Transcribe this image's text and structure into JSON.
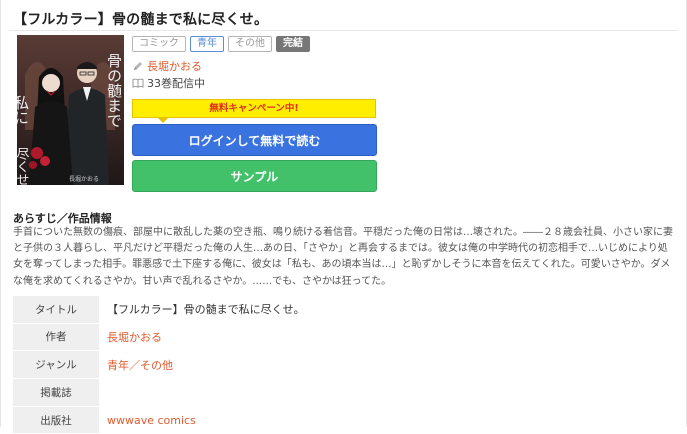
{
  "title": "【フルカラー】骨の髄まで私に尽くせ。",
  "tags": [
    {
      "label": "コミック",
      "style": "gray"
    },
    {
      "label": "青年",
      "style": "blue"
    },
    {
      "label": "その他",
      "style": "gray"
    },
    {
      "label": "完結",
      "style": "done"
    }
  ],
  "author": "長堀かおる",
  "volumes": "33巻配信中",
  "campaign": "無料キャンペーン中!",
  "buttons": {
    "login": "ログインして無料で読む",
    "sample": "サンプル"
  },
  "synopsis": {
    "heading": "あらすじ／作品情報",
    "text": "手首についた無数の傷痕、部屋中に散乱した薬の空き瓶、鳴り続ける着信音。平穏だった俺の日常は…壊された。――２８歳会社員、小さい家に妻と子供の３人暮らし、平凡だけど平穏だった俺の人生…あの日、「さやか」と再会するまでは。彼女は俺の中学時代の初恋相手で…いじめにより処女を奪ってしまった相手。罪悪感で土下座する俺に、彼女は「私も、あの頃本当は…」と恥ずかしそうに本音を伝えてくれた。可愛いさやか。ダメな俺を求めてくれるさやか。甘い声で乱れるさやか。……でも、さやかは狂ってた。"
  },
  "info": {
    "rows": [
      {
        "label": "タイトル",
        "value": "【フルカラー】骨の髄まで私に尽くせ。",
        "link": false
      },
      {
        "label": "作者",
        "value": "長堀かおる",
        "link": true
      },
      {
        "label": "ジャンル",
        "value": "青年／その他",
        "link": true
      },
      {
        "label": "掲載誌",
        "value": "",
        "link": false
      },
      {
        "label": "出版社",
        "value": "wwwave comics",
        "link": true
      }
    ]
  },
  "cover_text": {
    "title_art": "骨の髄まで私に尽くせ。",
    "author_art": "長堀かおる"
  },
  "colors": {
    "accent_orange": "#e05b2d",
    "login_blue": "#3a73df",
    "sample_green": "#43c16a",
    "campaign_yellow": "#ffee00",
    "campaign_red": "#e0301e"
  },
  "icons": {
    "author": "pen-icon",
    "volumes": "book-icon"
  }
}
